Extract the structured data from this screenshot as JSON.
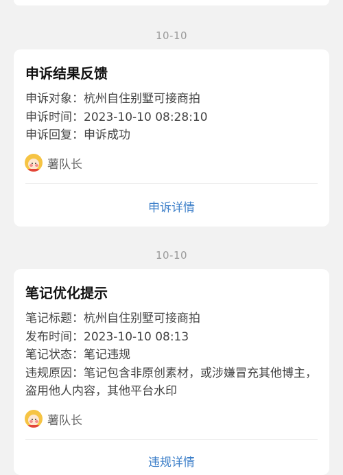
{
  "feed": {
    "messages": [
      {
        "date": "10-10",
        "title": "申诉结果反馈",
        "lines": [
          {
            "key": "申诉对象：",
            "value": "杭州自住别墅可接商拍"
          },
          {
            "key": "申诉时间：",
            "value": "2023-10-10 08:28:10"
          },
          {
            "key": "申诉回复：",
            "value": "申诉成功"
          }
        ],
        "author": "薯队长",
        "action": "申诉详情"
      },
      {
        "date": "10-10",
        "title": "笔记优化提示",
        "lines": [
          {
            "key": "笔记标题：",
            "value": "杭州自住别墅可接商拍"
          },
          {
            "key": "发布时间：",
            "value": "2023-10-10 08:13"
          },
          {
            "key": "笔记状态：",
            "value": "笔记违规"
          },
          {
            "key": "违规原因：",
            "value": "笔记包含非原创素材，或涉嫌冒充其他博主，盗用他人内容，其他平台水印"
          }
        ],
        "author": "薯队长",
        "action": "违规详情"
      }
    ]
  },
  "colors": {
    "background": "#f2f2f2",
    "card": "#ffffff",
    "link": "#3d7fc9",
    "avatar": "#f6c444"
  },
  "icons": {
    "author_avatar": "potato-mascot-avatar"
  }
}
